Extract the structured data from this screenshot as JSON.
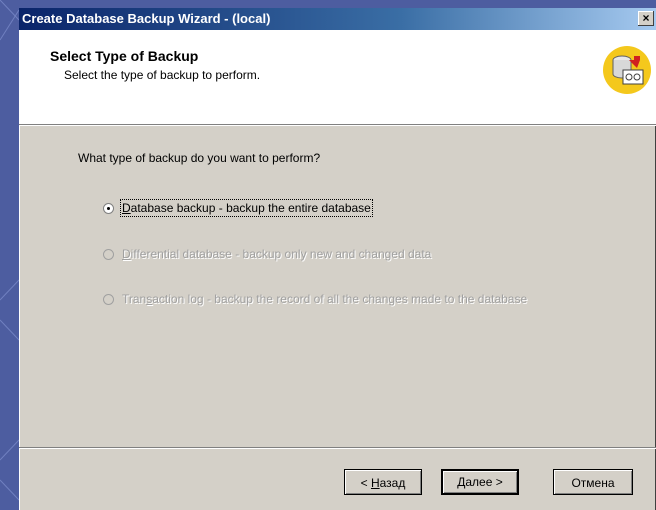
{
  "window": {
    "title": "Create Database Backup Wizard - (local)",
    "close_glyph": "×"
  },
  "header": {
    "title": "Select Type of Backup",
    "subtitle": "Select the type of backup to perform.",
    "icon": "database-backup-icon"
  },
  "main": {
    "question": "What type of backup do you want to perform?",
    "options": [
      {
        "label_pre": "",
        "label_accel": "D",
        "label_post": "atabase backup - backup the entire database",
        "checked": true,
        "enabled": true
      },
      {
        "label_pre": "",
        "label_accel": "D",
        "label_post": "ifferential database - backup only new and changed data",
        "checked": false,
        "enabled": false
      },
      {
        "label_pre": "Tran",
        "label_accel": "s",
        "label_post": "action log - backup the record of all the changes made to the database",
        "checked": false,
        "enabled": false
      }
    ]
  },
  "buttons": {
    "back": {
      "pre": "< ",
      "accel": "Н",
      "post": "азад"
    },
    "next": {
      "pre": "",
      "accel": "Д",
      "post": "алее >"
    },
    "cancel": "Отмена"
  },
  "colors": {
    "titlebar_start": "#0a246a",
    "titlebar_end": "#a6caf0",
    "dialog_face": "#d4d0c8",
    "desktop": "#4a5a9c"
  }
}
